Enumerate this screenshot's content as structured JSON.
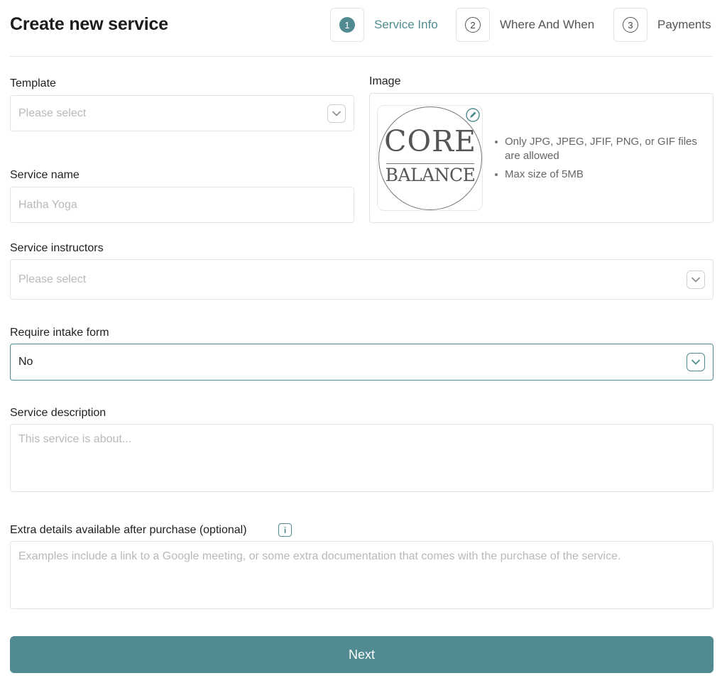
{
  "page": {
    "title": "Create new service"
  },
  "steps": [
    {
      "number": "1",
      "label": "Service Info",
      "active": true
    },
    {
      "number": "2",
      "label": "Where And When",
      "active": false
    },
    {
      "number": "3",
      "label": "Payments",
      "active": false
    }
  ],
  "template": {
    "label": "Template",
    "placeholder": "Please select"
  },
  "service_name": {
    "label": "Service name",
    "placeholder": "Hatha Yoga"
  },
  "image": {
    "label": "Image",
    "logo_text_top": "CORE",
    "logo_text_bottom": "BALANCE",
    "rules": [
      "Only JPG, JPEG, JFIF, PNG, or GIF files are allowed",
      "Max size of 5MB"
    ]
  },
  "instructors": {
    "label": "Service instructors",
    "placeholder": "Please select"
  },
  "intake_form": {
    "label": "Require intake form",
    "value": "No"
  },
  "description": {
    "label": "Service description",
    "placeholder": "This service is about..."
  },
  "extra_details": {
    "label": "Extra details available after purchase (optional)",
    "info_icon_text": "i",
    "placeholder": "Examples include a link to a Google meeting, or some extra documentation that comes with the purchase of the service."
  },
  "actions": {
    "next_label": "Next"
  },
  "colors": {
    "accent": "#518b91",
    "border": "#e3e3e3",
    "placeholder": "#b9b9b9"
  }
}
